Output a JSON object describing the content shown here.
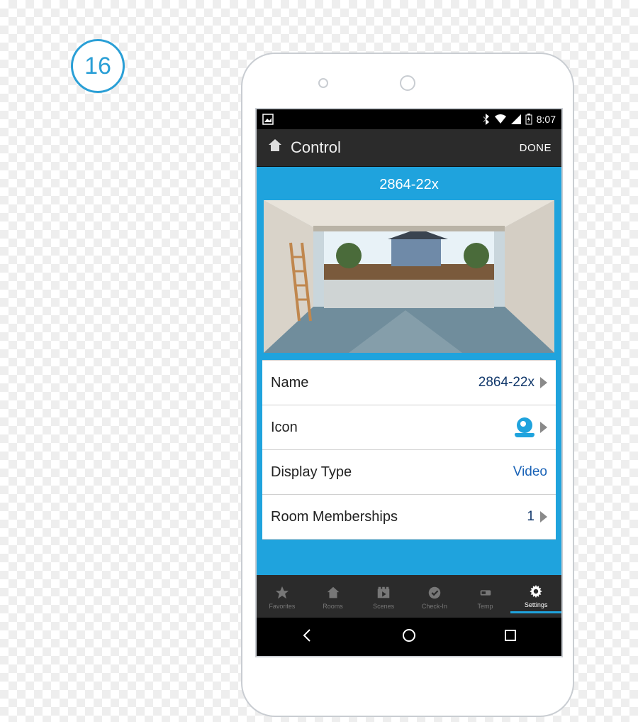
{
  "step_number": "16",
  "status": {
    "time": "8:07"
  },
  "header": {
    "title": "Control",
    "done": "DONE"
  },
  "device": {
    "title": "2864-22x"
  },
  "rows": {
    "name": {
      "label": "Name",
      "value": "2864-22x"
    },
    "icon": {
      "label": "Icon"
    },
    "display": {
      "label": "Display Type",
      "value": "Video"
    },
    "rooms": {
      "label": "Room Memberships",
      "value": "1"
    }
  },
  "tabs": {
    "favorites": "Favorites",
    "rooms": "Rooms",
    "scenes": "Scenes",
    "checkin": "Check-In",
    "temp": "Temp",
    "settings": "Settings"
  }
}
